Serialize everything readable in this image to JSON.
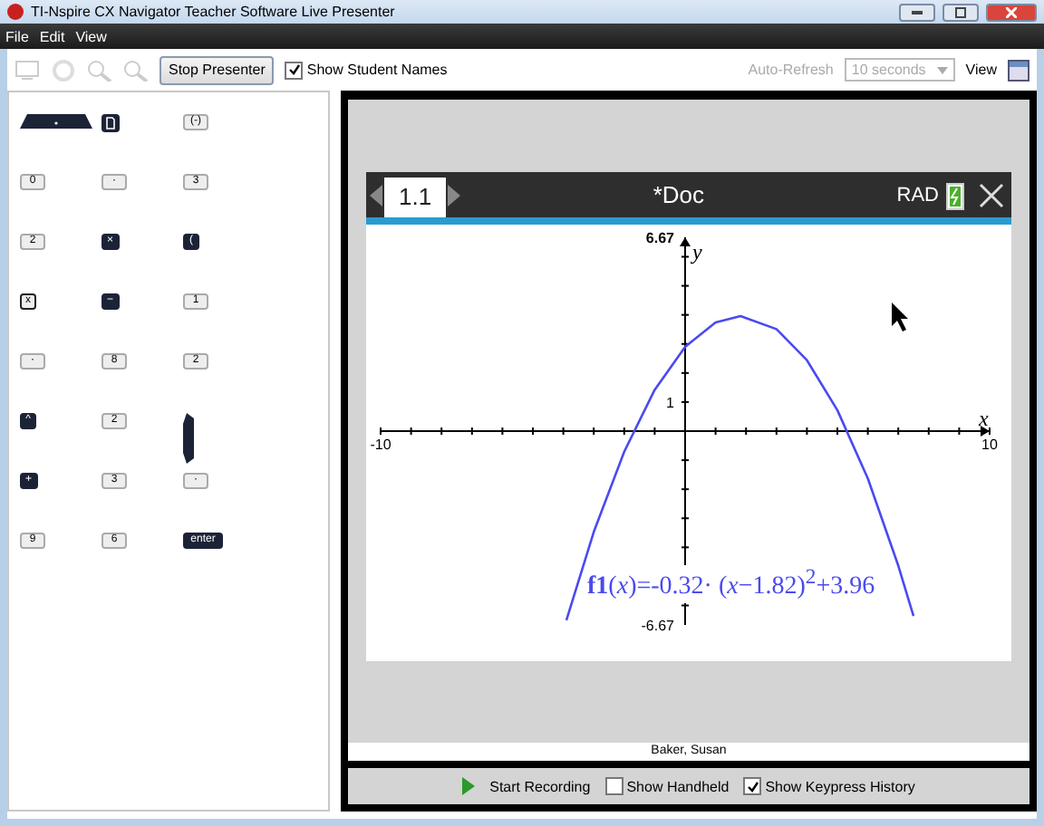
{
  "window": {
    "title": "TI-Nspire CX Navigator Teacher Software Live Presenter"
  },
  "menu": [
    "File",
    "Edit",
    "View"
  ],
  "toolbar": {
    "stop_button": "Stop Presenter",
    "show_names": {
      "label": "Show Student Names",
      "checked": true
    },
    "auto_refresh": {
      "label": "Auto-Refresh",
      "value": "10 seconds",
      "disabled": true
    },
    "view": "View"
  },
  "keypress_history": [
    {
      "kind": "touchpad"
    },
    {
      "kind": "doc"
    },
    {
      "kind": "light",
      "label": "(-)"
    },
    {
      "kind": "light",
      "label": "0"
    },
    {
      "kind": "light",
      "label": "·"
    },
    {
      "kind": "light",
      "label": "3"
    },
    {
      "kind": "light",
      "label": "2"
    },
    {
      "kind": "dark",
      "label": "×"
    },
    {
      "kind": "dark",
      "label": "("
    },
    {
      "kind": "outlined",
      "label": "x"
    },
    {
      "kind": "dark",
      "label": "−"
    },
    {
      "kind": "light",
      "label": "1"
    },
    {
      "kind": "light",
      "label": "·"
    },
    {
      "kind": "light",
      "label": "8"
    },
    {
      "kind": "light",
      "label": "2"
    },
    {
      "kind": "dark",
      "label": "^"
    },
    {
      "kind": "light",
      "label": "2"
    },
    {
      "kind": "side"
    },
    {
      "kind": "dark",
      "label": "+"
    },
    {
      "kind": "light",
      "label": "3"
    },
    {
      "kind": "light",
      "label": "·"
    },
    {
      "kind": "light",
      "label": "9"
    },
    {
      "kind": "light",
      "label": "6"
    },
    {
      "kind": "dark",
      "label": "enter"
    }
  ],
  "handheld": {
    "tabs": [
      {
        "label": "1.1",
        "selected": true
      }
    ],
    "document": "*Doc",
    "angle_mode": "RAD",
    "graph": {
      "formula": "**f1**(*x*)=-0.32· (*x*−1.82)$^{2}$+3.96",
      "chart_data": {
        "type": "line",
        "xlabel": "x",
        "ylabel": "y",
        "xlim": [
          -10,
          10
        ],
        "ylim": [
          -6.67,
          6.67
        ],
        "xticks": [
          -10,
          10
        ],
        "yticks": [
          -6.67,
          1,
          6.67
        ],
        "x": [
          -3.9,
          -3,
          -2,
          -1,
          0,
          1,
          1.82,
          3,
          4,
          5,
          6,
          7,
          7.5
        ],
        "series": [
          {
            "color": "#4a4af0",
            "values": [
              -6.51,
              -3.47,
              -0.71,
              1.42,
              2.9,
              3.74,
              3.96,
              3.51,
              2.44,
              0.72,
              -1.63,
              -4.63,
              -6.36
            ]
          }
        ]
      }
    }
  },
  "student_name": "Baker, Susan",
  "bottom_bar": {
    "record": "Start Recording",
    "options": [
      {
        "label": "Show Handheld",
        "checked": false
      },
      {
        "label": "Show Keypress History",
        "checked": true
      }
    ]
  }
}
